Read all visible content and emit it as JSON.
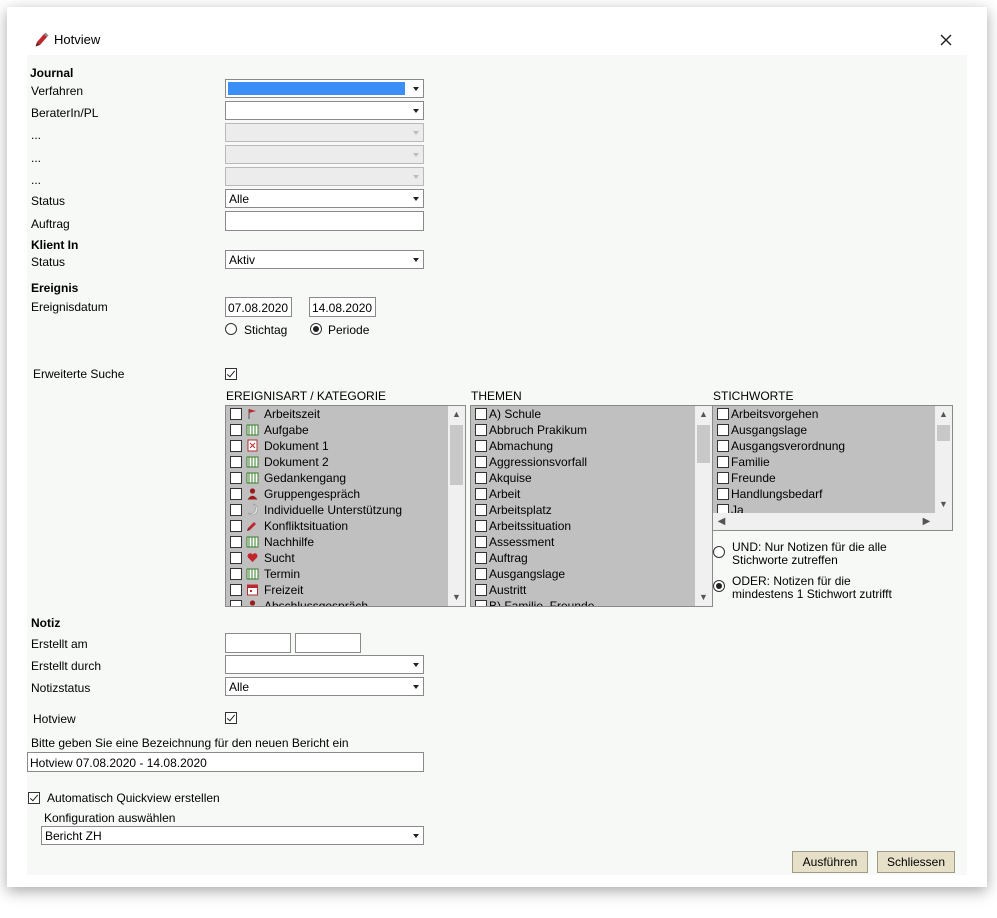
{
  "window": {
    "title": "Hotview",
    "icon": "pencil-icon",
    "close_icon": "close-icon"
  },
  "journal": {
    "header": "Journal",
    "verfahren_label": "Verfahren",
    "berater_label": "BeraterIn/PL",
    "dots_label": "...",
    "status_label": "Status",
    "status_value": "Alle",
    "auftrag_label": "Auftrag",
    "auftrag_value": ""
  },
  "klient": {
    "header": "Klient In",
    "status_label": "Status",
    "status_value": "Aktiv"
  },
  "ereignis": {
    "header": "Ereignis",
    "datum_label": "Ereignisdatum",
    "date_from": "07.08.2020",
    "date_to": "14.08.2020",
    "radio_stichtag": "Stichtag",
    "radio_periode": "Periode"
  },
  "erweiterte": {
    "label": "Erweiterte Suche",
    "checked": true,
    "col_ereignisart": "EREIGNISART / KATEGORIE",
    "col_themen": "THEMEN",
    "col_stichworte": "STICHWORTE",
    "ereignisart_items": [
      {
        "label": "Arbeitszeit",
        "icon": "clock-flag-icon"
      },
      {
        "label": "Aufgabe",
        "icon": "tasks-icon"
      },
      {
        "label": "Dokument 1",
        "icon": "document-icon"
      },
      {
        "label": "Dokument 2",
        "icon": "tasks-icon"
      },
      {
        "label": "Gedankengang",
        "icon": "tasks-icon"
      },
      {
        "label": "Gruppengespräch",
        "icon": "person-icon"
      },
      {
        "label": "Individuelle Unterstützung",
        "icon": "moon-icon"
      },
      {
        "label": "Konfliktsituation",
        "icon": "pencil-icon"
      },
      {
        "label": "Nachhilfe",
        "icon": "tasks-icon"
      },
      {
        "label": "Sucht",
        "icon": "heart-icon"
      },
      {
        "label": "Termin",
        "icon": "tasks-icon"
      },
      {
        "label": "Freizeit",
        "icon": "calendar-icon"
      },
      {
        "label": "Abschlussgespräch",
        "icon": "person-icon"
      }
    ],
    "themen_items": [
      "A) Schule",
      "Abbruch Prakikum",
      "Abmachung",
      "Aggressionsvorfall",
      "Akquise",
      "Arbeit",
      "Arbeitsplatz",
      "Arbeitssituation",
      "Assessment",
      "Auftrag",
      "Ausgangslage",
      "Austritt",
      "B) Familie, Freunde"
    ],
    "stichworte_items": [
      "Arbeitsvorgehen",
      "Ausgangslage",
      "Ausgangsverordnung",
      "Familie",
      "Freunde",
      "Handlungsbedarf",
      "Ja"
    ],
    "radio_und": "UND: Nur Notizen für die alle Stichworte zutreffen",
    "radio_und_l1": "UND: Nur Notizen für die alle",
    "radio_und_l2": "Stichworte zutreffen",
    "radio_oder_l1": "ODER: Notizen für die",
    "radio_oder_l2": "mindestens 1 Stichwort zutrifft"
  },
  "notiz": {
    "header": "Notiz",
    "erstellt_am_label": "Erstellt am",
    "erstellt_durch_label": "Erstellt durch",
    "notizstatus_label": "Notizstatus",
    "notizstatus_value": "Alle"
  },
  "hotview": {
    "label": "Hotview",
    "checked": true,
    "bezeichnung_label": "Bitte geben Sie eine Bezeichnung für den neuen Bericht ein",
    "bezeichnung_value": "Hotview 07.08.2020 - 14.08.2020"
  },
  "quickview": {
    "label": "Automatisch Quickview erstellen",
    "checked": true,
    "konfig_label": "Konfiguration auswählen",
    "konfig_value": "Bericht ZH"
  },
  "buttons": {
    "ausfuehren": "Ausführen",
    "schliessen": "Schliessen"
  }
}
